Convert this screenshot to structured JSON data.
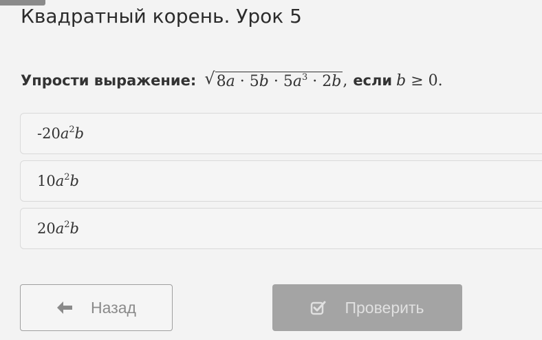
{
  "header": {
    "title": "Квадратный корень. Урок 5"
  },
  "question": {
    "label": "Упрости выражение:",
    "radicand": {
      "t1_coef": "8",
      "t1_var": "a",
      "dot": "·",
      "t2_coef": "5",
      "t2_var": "b",
      "t3_coef": "5",
      "t3_var": "a",
      "t3_exp": "3",
      "t4_coef": "2",
      "t4_var": "b"
    },
    "comma": ",",
    "condition_word": "если",
    "condition": {
      "var": "b",
      "op": "≥",
      "value": "0."
    }
  },
  "options": [
    {
      "sign": "-",
      "coef": "20",
      "var1": "a",
      "exp": "2",
      "var2": "b"
    },
    {
      "sign": "",
      "coef": "10",
      "var1": "a",
      "exp": "2",
      "var2": "b"
    },
    {
      "sign": "",
      "coef": "20",
      "var1": "a",
      "exp": "2",
      "var2": "b"
    }
  ],
  "buttons": {
    "back_label": "Назад",
    "back_icon": "arrow-left-icon",
    "check_label": "Проверить",
    "check_icon": "checkbox-checked-icon"
  },
  "colors": {
    "background": "#f3f3f3",
    "text": "#333333",
    "option_border": "#d9d9d9",
    "check_button_bg": "#a4a4a4",
    "back_button_border": "#9e9e9e"
  }
}
